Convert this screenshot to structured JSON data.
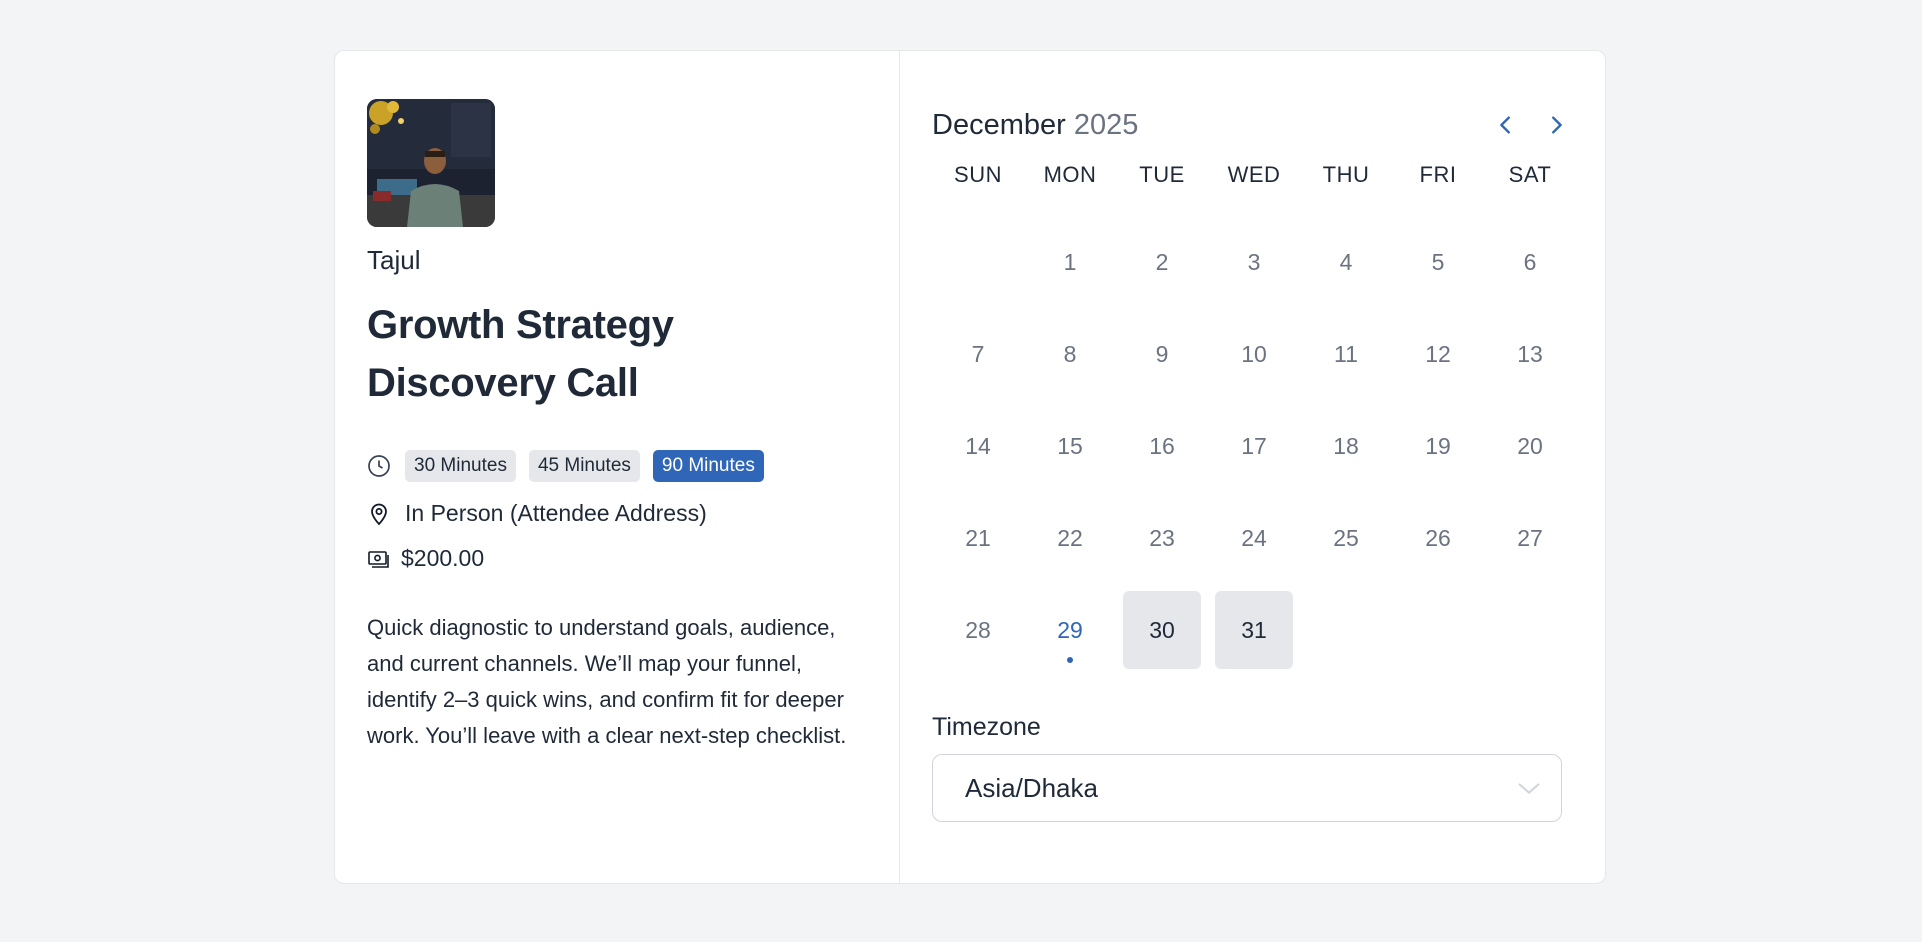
{
  "host": {
    "name": "Tajul",
    "avatar_alt": "Host photo"
  },
  "event": {
    "title": "Growth Strategy Discovery Call",
    "durations": [
      {
        "label": "30 Minutes",
        "active": false
      },
      {
        "label": "45 Minutes",
        "active": false
      },
      {
        "label": "90 Minutes",
        "active": true
      }
    ],
    "location": "In Person (Attendee Address)",
    "price": "$200.00",
    "description": "Quick diagnostic to understand goals, audience, and current channels. We’ll map your funnel, identify 2–3 quick wins, and confirm fit for deeper work. You’ll leave with a clear next-step checklist."
  },
  "calendar": {
    "month": "December",
    "year": "2025",
    "weekdays": [
      "SUN",
      "MON",
      "TUE",
      "WED",
      "THU",
      "FRI",
      "SAT"
    ],
    "days": [
      {
        "label": "",
        "state": "empty"
      },
      {
        "label": "1",
        "state": "disabled"
      },
      {
        "label": "2",
        "state": "disabled"
      },
      {
        "label": "3",
        "state": "disabled"
      },
      {
        "label": "4",
        "state": "disabled"
      },
      {
        "label": "5",
        "state": "disabled"
      },
      {
        "label": "6",
        "state": "disabled"
      },
      {
        "label": "7",
        "state": "disabled"
      },
      {
        "label": "8",
        "state": "disabled"
      },
      {
        "label": "9",
        "state": "disabled"
      },
      {
        "label": "10",
        "state": "disabled"
      },
      {
        "label": "11",
        "state": "disabled"
      },
      {
        "label": "12",
        "state": "disabled"
      },
      {
        "label": "13",
        "state": "disabled"
      },
      {
        "label": "14",
        "state": "disabled"
      },
      {
        "label": "15",
        "state": "disabled"
      },
      {
        "label": "16",
        "state": "disabled"
      },
      {
        "label": "17",
        "state": "disabled"
      },
      {
        "label": "18",
        "state": "disabled"
      },
      {
        "label": "19",
        "state": "disabled"
      },
      {
        "label": "20",
        "state": "disabled"
      },
      {
        "label": "21",
        "state": "disabled"
      },
      {
        "label": "22",
        "state": "disabled"
      },
      {
        "label": "23",
        "state": "disabled"
      },
      {
        "label": "24",
        "state": "disabled"
      },
      {
        "label": "25",
        "state": "disabled"
      },
      {
        "label": "26",
        "state": "disabled"
      },
      {
        "label": "27",
        "state": "disabled"
      },
      {
        "label": "28",
        "state": "disabled"
      },
      {
        "label": "29",
        "state": "today"
      },
      {
        "label": "30",
        "state": "available"
      },
      {
        "label": "31",
        "state": "available"
      }
    ]
  },
  "timezone": {
    "label": "Timezone",
    "value": "Asia/Dhaka"
  },
  "icons": {
    "duration": "clock-icon",
    "location": "map-pin-icon",
    "price": "cash-icon",
    "prev": "chevron-left-icon",
    "next": "chevron-right-icon",
    "dropdown": "chevron-down-icon"
  },
  "colors": {
    "accent": "#2f66b8",
    "pill_bg": "#e5e7eb",
    "background": "#f3f4f6"
  }
}
